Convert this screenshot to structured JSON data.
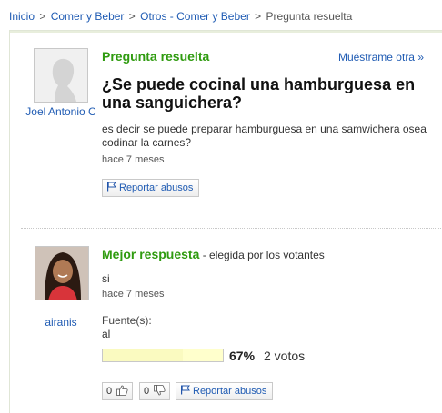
{
  "breadcrumb": {
    "items": [
      "Inicio",
      "Comer y Beber",
      "Otros - Comer y Beber"
    ],
    "current": "Pregunta resuelta",
    "separator": ">"
  },
  "question": {
    "status_label": "Pregunta resuelta",
    "show_other_label": "Muéstrame otra »",
    "title": "¿Se puede cocinal una hamburguesa en una sanguichera?",
    "body": "es decir se puede preparar hamburguesa en una samwichera osea codinar la carnes?",
    "time": "hace 7 meses",
    "report_label": "Reportar abusos",
    "asker_name": "Joel Antonio C"
  },
  "answer": {
    "heading": "Mejor respuesta",
    "heading_note": " - elegida por los votantes",
    "text": "si",
    "time": "hace 7 meses",
    "source_label": "Fuente(s):",
    "source_value": "al",
    "vote_percent_text": "67%",
    "vote_fraction": 0.67,
    "vote_count_text": "2 votos",
    "thumbs_up_count": "0",
    "thumbs_down_count": "0",
    "report_label": "Reportar abusos",
    "answerer_name": "airanis"
  },
  "colors": {
    "link": "#1f5bb3",
    "section_title": "#2f9b0f"
  }
}
